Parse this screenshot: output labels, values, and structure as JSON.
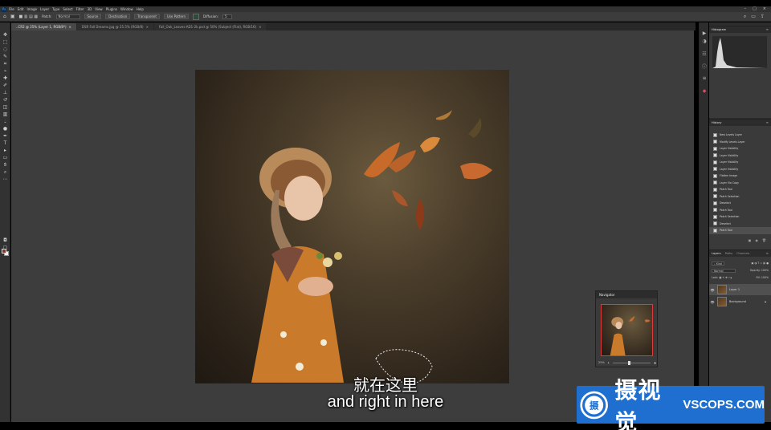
{
  "menubar": {
    "logo": "Ps",
    "items": [
      "File",
      "Edit",
      "Image",
      "Layer",
      "Type",
      "Select",
      "Filter",
      "3D",
      "View",
      "Plugins",
      "Window",
      "Help"
    ]
  },
  "options": {
    "patch_label": "Patch:",
    "patch_mode": "Normal",
    "source": "Source",
    "destination": "Destination",
    "transparent": "Transparent",
    "use_pattern": "Use Pattern",
    "diffusion_label": "Diffusion:",
    "diffusion_value": "5"
  },
  "tabs": [
    {
      "label": "..CR2 @ 25% (Layer 1, RGB/8*)",
      "active": true
    },
    {
      "label": "DSR Fall Dreams.jpg @ 25.5% (RGB/8)",
      "active": false
    },
    {
      "label": "Fall_Oak_Leaves-AD1-2k.psd @ 50% (Subject (Flat), RGB/16)",
      "active": false
    }
  ],
  "panels": {
    "histogram_tab": "Histogram",
    "history_tab": "History",
    "history_items": [
      "New Levels Layer",
      "Modify Levels Layer",
      "Layer Visibility",
      "Layer Visibility",
      "Layer Visibility",
      "Layer Visibility",
      "Flatten Image",
      "Layer Via Copy",
      "Patch Tool",
      "Patch Selection",
      "Deselect",
      "Patch Tool",
      "Patch Selection",
      "Deselect",
      "Patch Tool"
    ],
    "layers_tabs": [
      "Layers",
      "Paths",
      "Channels"
    ],
    "kind_filter": "Kind",
    "blend_mode": "Normal",
    "opacity_label": "Opacity:",
    "opacity_value": "100%",
    "lock_label": "Lock:",
    "fill_label": "Fill:",
    "fill_value": "100%",
    "layers": [
      {
        "name": "Layer 1",
        "selected": true
      },
      {
        "name": "Background",
        "selected": false
      }
    ]
  },
  "navigator": {
    "title": "Navigator",
    "zoom": "25%"
  },
  "subtitles": {
    "cn": "就在这里",
    "en": "and right in here"
  },
  "watermark": {
    "cn": "摄视觉",
    "en": "VSCOPS.COM",
    "logo_glyph": "摄"
  }
}
